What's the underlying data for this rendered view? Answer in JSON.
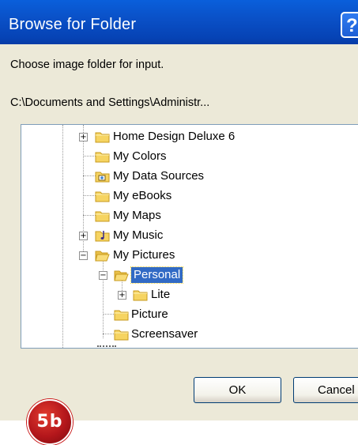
{
  "window": {
    "title": "Browse for Folder",
    "help_label": "?"
  },
  "prompt": "Choose image folder for input.",
  "current_path": "C:\\Documents and Settings\\Administr...",
  "tree": {
    "items": [
      {
        "label": "Home Design Deluxe 6",
        "expander": "+"
      },
      {
        "label": "My Colors",
        "expander": ""
      },
      {
        "label": "My Data Sources",
        "expander": ""
      },
      {
        "label": "My eBooks",
        "expander": ""
      },
      {
        "label": "My Maps",
        "expander": ""
      },
      {
        "label": "My Music",
        "expander": "+"
      },
      {
        "label": "My Pictures",
        "expander": "−"
      },
      {
        "label": "Personal",
        "expander": "−",
        "selected": true
      },
      {
        "label": "Lite",
        "expander": "+"
      },
      {
        "label": "Picture",
        "expander": ""
      },
      {
        "label": "Screensaver",
        "expander": ""
      }
    ]
  },
  "buttons": {
    "ok": "OK",
    "cancel": "Cancel"
  },
  "badge": "5b",
  "colors": {
    "titlebar": "#0a51c8",
    "selection": "#316ac5",
    "folder": "#f6d462",
    "badge": "#c41b1b",
    "dialog_bg": "#ece9d8"
  }
}
